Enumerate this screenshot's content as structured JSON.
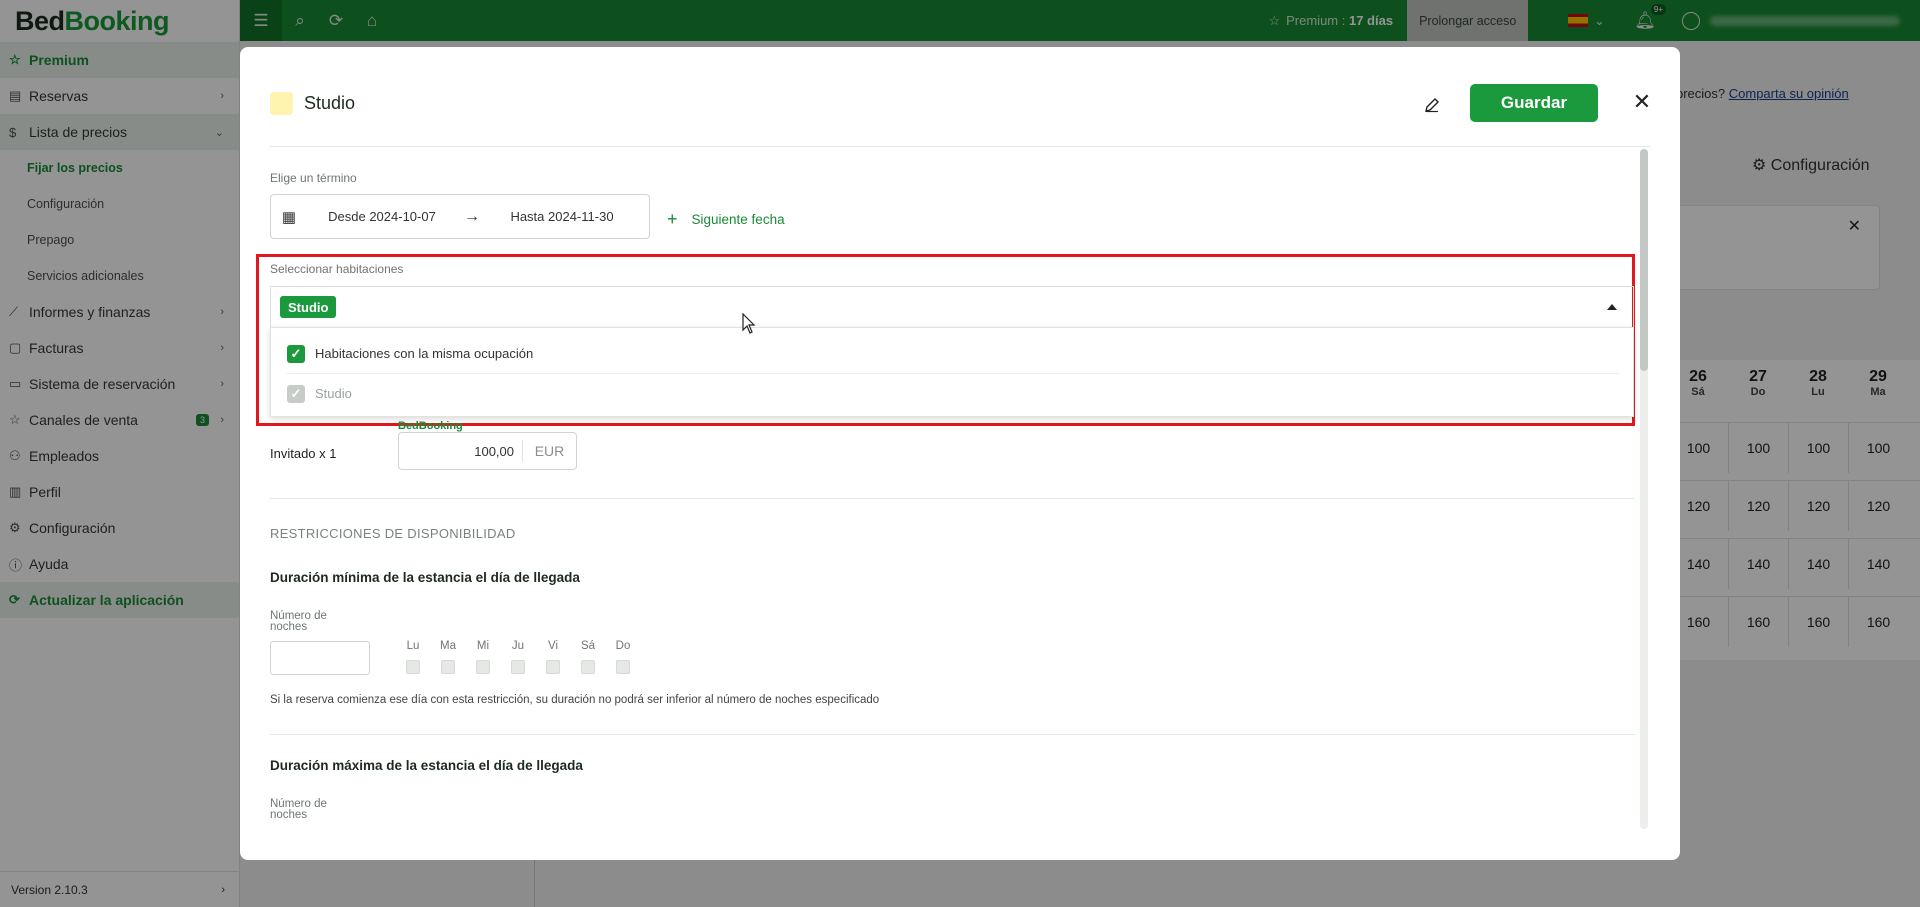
{
  "brand": {
    "part1": "Bed",
    "part2": "Booking"
  },
  "topbar": {
    "premium_label": "Premium : ",
    "premium_days": "17 días",
    "prolong_label": "Prolongar acceso",
    "notif_badge": "9+"
  },
  "sidebar": {
    "items": [
      {
        "label": "Premium",
        "icon": "star-icon"
      },
      {
        "label": "Reservas",
        "icon": "calendar-icon"
      },
      {
        "label": "Lista de precios",
        "icon": "dollar-icon"
      },
      {
        "label": "Informes y finanzas",
        "icon": "chart-icon"
      },
      {
        "label": "Facturas",
        "icon": "invoice-icon"
      },
      {
        "label": "Sistema de reservación",
        "icon": "desktop-icon"
      },
      {
        "label": "Canales de venta",
        "icon": "star-icon",
        "badge": "3"
      },
      {
        "label": "Empleados",
        "icon": "people-icon"
      },
      {
        "label": "Perfil",
        "icon": "building-icon"
      },
      {
        "label": "Configuración",
        "icon": "gear-icon"
      },
      {
        "label": "Ayuda",
        "icon": "info-icon"
      },
      {
        "label": "Actualizar la aplicación",
        "icon": "refresh-icon"
      }
    ],
    "sub_items": [
      "Fijar los precios",
      "Configuración",
      "Prepago",
      "Servicios adicionales"
    ],
    "version": "Version 2.10.3"
  },
  "background": {
    "link_prefix": "precios? ",
    "link_text": "Comparta su opinión",
    "config_label": "Configuración",
    "days": [
      {
        "num": "26",
        "name": "Sá"
      },
      {
        "num": "27",
        "name": "Do"
      },
      {
        "num": "28",
        "name": "Lu"
      },
      {
        "num": "29",
        "name": "Ma"
      }
    ],
    "rows": [
      [
        "100",
        "100",
        "100",
        "100"
      ],
      [
        "120",
        "120",
        "120",
        "120"
      ],
      [
        "140",
        "140",
        "140",
        "140"
      ],
      [
        "160",
        "160",
        "160",
        "160"
      ]
    ]
  },
  "modal": {
    "title": "Studio",
    "save_label": "Guardar",
    "term_label": "Elige un término",
    "from_date": "Desde 2024-10-07",
    "to_date": "Hasta 2024-11-30",
    "next_date_label": "Siguiente fecha",
    "rooms_label": "Seleccionar habitaciones",
    "selected_chip": "Studio",
    "options": [
      {
        "label": "Habitaciones con la misma ocupación",
        "checked": true,
        "disabled": false
      },
      {
        "label": "Studio",
        "checked": true,
        "disabled": true
      }
    ],
    "bedbooking_label": "BedBooking",
    "guest_label": "Invitado x 1",
    "price_value": "100,00",
    "currency": "EUR",
    "availability_caption": "RESTRICCIONES DE DISPONIBILIDAD",
    "min_stay_heading": "Duración mínima de la estancia el día de llegada",
    "nights_label": "Número de noches",
    "weekdays": [
      "Lu",
      "Ma",
      "Mi",
      "Ju",
      "Vi",
      "Sá",
      "Do"
    ],
    "min_stay_hint": "Si la reserva comienza ese día con esta restricción, su duración no podrá ser inferior al número de noches especificado",
    "max_stay_heading": "Duración máxima de la estancia el día de llegada",
    "nights_label_2": "Número de noches"
  },
  "colors": {
    "brand_green": "#178a32",
    "accent_green": "#1a9a3c",
    "highlight_red": "#e1191e"
  }
}
